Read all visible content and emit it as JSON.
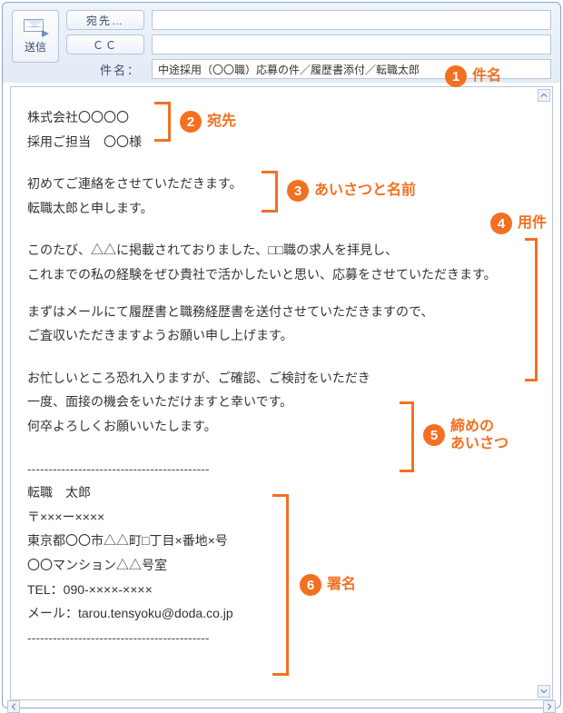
{
  "toolbar": {
    "send_label": "送信",
    "to_label": "宛先…",
    "cc_label": "ＣＣ",
    "subject_label": "件名："
  },
  "fields": {
    "to_value": "",
    "cc_value": "",
    "subject_value": "中途採用（〇〇職）応募の件／履歴書添付／転職太郎"
  },
  "body": {
    "addressee": {
      "line1": "株式会社〇〇〇〇",
      "line2": "採用ご担当　〇〇様"
    },
    "greeting": {
      "line1": "初めてご連絡をさせていただきます。",
      "line2": "転職太郎と申します。"
    },
    "purpose": {
      "line1": "このたび、△△に掲載されておりました、□□職の求人を拝見し、",
      "line2": "これまでの私の経験をぜひ貴社で活かしたいと思い、応募をさせていただきます。",
      "line3": "まずはメールにて履歴書と職務経歴書を送付させていただきますので、",
      "line4": "ご査収いただきますようお願い申し上げます。"
    },
    "closing": {
      "line1": "お忙しいところ恐れ入りますが、ご確認、ご検討をいただき",
      "line2": "一度、面接の機会をいただけますと幸いです。",
      "line3": "何卒よろしくお願いいたします。"
    },
    "signature": {
      "divider": "-------------------------------------------",
      "name": "転職　太郎",
      "postal": "〒×××ー××××",
      "addr1": "東京都〇〇市△△町□丁目×番地×号",
      "addr2": "〇〇マンション△△号室",
      "tel": "TEL：090-××××-××××",
      "mail": "メール：tarou.tensyoku@doda.co.jp"
    }
  },
  "annotations": {
    "a1": "件名",
    "a2": "宛先",
    "a3": "あいさつと名前",
    "a4": "用件",
    "a5a": "締めの",
    "a5b": "あいさつ",
    "a6": "署名"
  },
  "colors": {
    "accent": "#f37021",
    "frame": "#8fa6c7"
  }
}
